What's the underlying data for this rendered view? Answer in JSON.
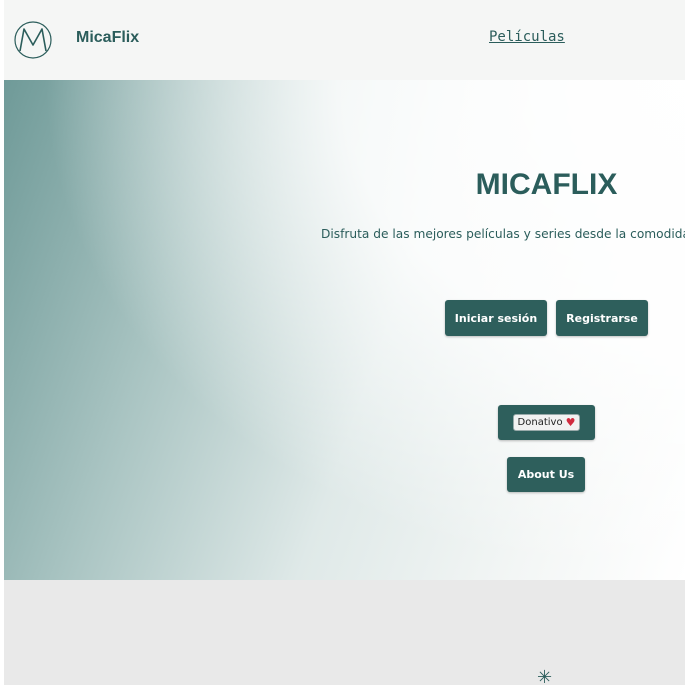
{
  "header": {
    "brand": "MicaFlix",
    "nav_link": "Películas"
  },
  "hero": {
    "title": "MICAFLIX",
    "subtitle": "Disfruta de las mejores películas y series desde la comodidad de tu hogar",
    "login_label": "Iniciar sesión",
    "register_label": "Registrarse",
    "donate_label": "Donativo",
    "about_label": "About Us"
  },
  "footer": {
    "sparkle_glyph": "✳"
  },
  "colors": {
    "accent": "#2e5f5c",
    "footer_bg": "#e9e9e9"
  }
}
